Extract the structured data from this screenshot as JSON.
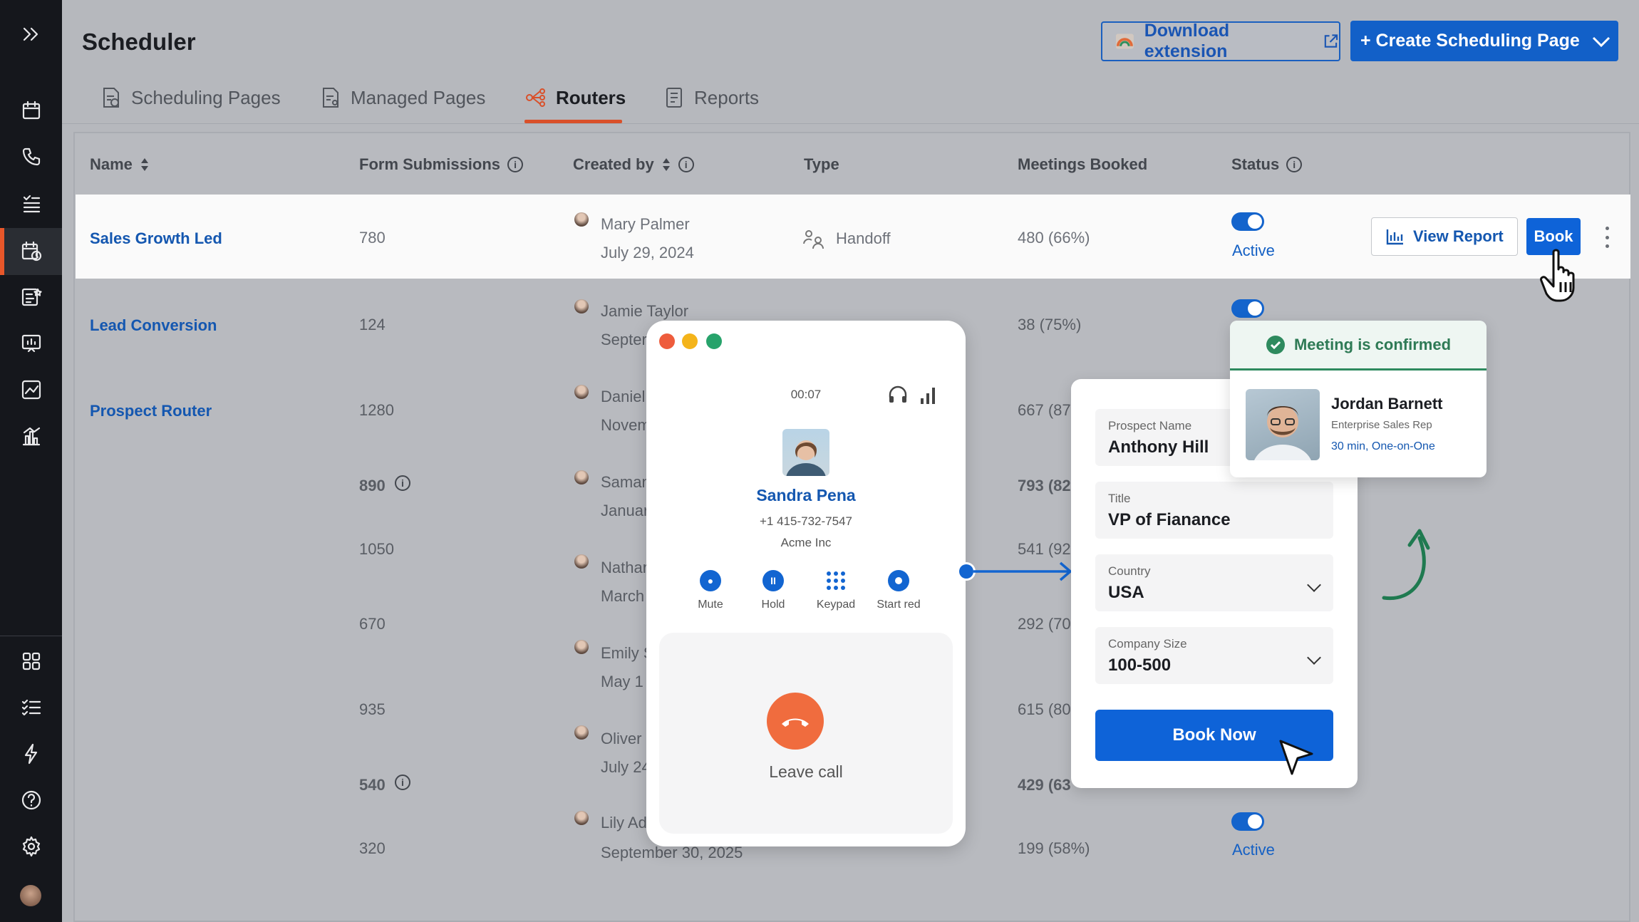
{
  "app": {
    "title": "Scheduler"
  },
  "header": {
    "download_label": "Download extension",
    "create_label": "+ Create Scheduling Page"
  },
  "tabs": [
    {
      "label": "Scheduling Pages"
    },
    {
      "label": "Managed Pages"
    },
    {
      "label": "Routers"
    },
    {
      "label": "Reports"
    }
  ],
  "table": {
    "columns": {
      "name": "Name",
      "form_submissions": "Form Submissions",
      "created_by": "Created by",
      "type": "Type",
      "meetings_booked": "Meetings Booked",
      "status": "Status"
    },
    "rows": [
      {
        "name": "Sales Growth Led",
        "submissions": "780",
        "creator": "Mary Palmer",
        "date": "July 29, 2024",
        "type": "Handoff",
        "meetings": "480 (66%)",
        "status": "Active"
      },
      {
        "name": "Lead Conversion",
        "submissions": "124",
        "creator": "Jamie Taylor",
        "date": "Septer",
        "type": "",
        "meetings": "38 (75%)",
        "status": ""
      },
      {
        "name": "Prospect Router",
        "submissions": "1280",
        "creator": "Daniel",
        "date": "Novem",
        "meetings": "667 (87"
      },
      {
        "name": "",
        "submissions": "890",
        "creator": "Saman",
        "date": "Januar",
        "meetings": "793 (82"
      },
      {
        "name": "",
        "submissions": "1050",
        "creator": "Nathar",
        "date": "March",
        "meetings": "541 (92"
      },
      {
        "name": "",
        "submissions": "670",
        "creator": "Emily S",
        "date": "May 1",
        "meetings": "292 (70"
      },
      {
        "name": "",
        "submissions": "935",
        "creator": "Oliver",
        "date": "July 24",
        "meetings": "615 (80"
      },
      {
        "name": "",
        "submissions": "540",
        "creator": "",
        "date": "",
        "meetings": "429 (63"
      },
      {
        "name": "",
        "submissions": "320",
        "creator": "Lily Ad",
        "date": "September 30, 2025",
        "meetings": "199 (58%)",
        "status": "Active"
      }
    ],
    "view_report_label": "View Report",
    "book_label": "Book"
  },
  "call": {
    "timer": "00:07",
    "name": "Sandra Pena",
    "phone": "+1 415-732-7547",
    "company": "Acme Inc",
    "controls": [
      "Mute",
      "Hold",
      "Keypad",
      "Start red"
    ],
    "leave_label": "Leave call"
  },
  "form": {
    "fields": [
      {
        "label": "Prospect Name",
        "value": "Anthony Hill"
      },
      {
        "label": "Title",
        "value": "VP of Fianance"
      },
      {
        "label": "Country",
        "value": "USA"
      },
      {
        "label": "Company Size",
        "value": "100-500"
      }
    ],
    "book_now_label": "Book Now"
  },
  "confirmation": {
    "heading": "Meeting is confirmed",
    "name": "Jordan Barnett",
    "role": "Enterprise Sales Rep",
    "duration": "30 min, One-on-One"
  },
  "colors": {
    "accent": "#1260c8",
    "active_tab": "#d9502a",
    "confirm": "#2e8a5e",
    "leave": "#f06c3e"
  }
}
